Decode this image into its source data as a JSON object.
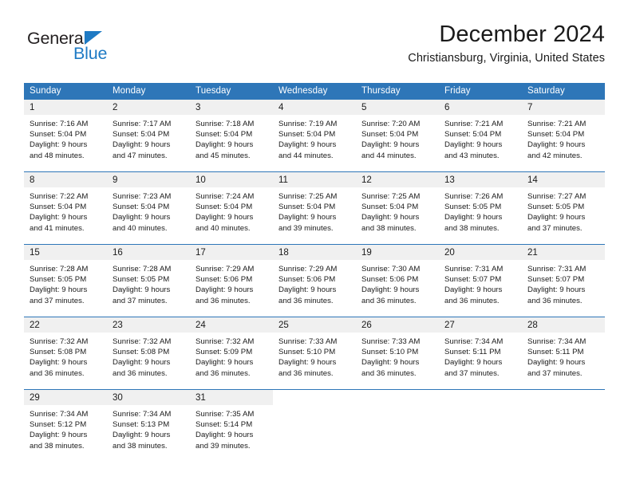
{
  "brand": {
    "name_top": "General",
    "name_bottom": "Blue",
    "accent_color": "#1e7ac4"
  },
  "header": {
    "title": "December 2024",
    "subtitle": "Christiansburg, Virginia, United States"
  },
  "theme": {
    "header_row_background": "#2e76b8",
    "daynum_background": "#f0f0f0",
    "grid_line": "#2e76b8",
    "text": "#1a1a1a"
  },
  "weekday_headers": [
    "Sunday",
    "Monday",
    "Tuesday",
    "Wednesday",
    "Thursday",
    "Friday",
    "Saturday"
  ],
  "weeks": [
    [
      {
        "day": "1",
        "sunrise": "Sunrise: 7:16 AM",
        "sunset": "Sunset: 5:04 PM",
        "daylight_line1": "Daylight: 9 hours",
        "daylight_line2": "and 48 minutes."
      },
      {
        "day": "2",
        "sunrise": "Sunrise: 7:17 AM",
        "sunset": "Sunset: 5:04 PM",
        "daylight_line1": "Daylight: 9 hours",
        "daylight_line2": "and 47 minutes."
      },
      {
        "day": "3",
        "sunrise": "Sunrise: 7:18 AM",
        "sunset": "Sunset: 5:04 PM",
        "daylight_line1": "Daylight: 9 hours",
        "daylight_line2": "and 45 minutes."
      },
      {
        "day": "4",
        "sunrise": "Sunrise: 7:19 AM",
        "sunset": "Sunset: 5:04 PM",
        "daylight_line1": "Daylight: 9 hours",
        "daylight_line2": "and 44 minutes."
      },
      {
        "day": "5",
        "sunrise": "Sunrise: 7:20 AM",
        "sunset": "Sunset: 5:04 PM",
        "daylight_line1": "Daylight: 9 hours",
        "daylight_line2": "and 44 minutes."
      },
      {
        "day": "6",
        "sunrise": "Sunrise: 7:21 AM",
        "sunset": "Sunset: 5:04 PM",
        "daylight_line1": "Daylight: 9 hours",
        "daylight_line2": "and 43 minutes."
      },
      {
        "day": "7",
        "sunrise": "Sunrise: 7:21 AM",
        "sunset": "Sunset: 5:04 PM",
        "daylight_line1": "Daylight: 9 hours",
        "daylight_line2": "and 42 minutes."
      }
    ],
    [
      {
        "day": "8",
        "sunrise": "Sunrise: 7:22 AM",
        "sunset": "Sunset: 5:04 PM",
        "daylight_line1": "Daylight: 9 hours",
        "daylight_line2": "and 41 minutes."
      },
      {
        "day": "9",
        "sunrise": "Sunrise: 7:23 AM",
        "sunset": "Sunset: 5:04 PM",
        "daylight_line1": "Daylight: 9 hours",
        "daylight_line2": "and 40 minutes."
      },
      {
        "day": "10",
        "sunrise": "Sunrise: 7:24 AM",
        "sunset": "Sunset: 5:04 PM",
        "daylight_line1": "Daylight: 9 hours",
        "daylight_line2": "and 40 minutes."
      },
      {
        "day": "11",
        "sunrise": "Sunrise: 7:25 AM",
        "sunset": "Sunset: 5:04 PM",
        "daylight_line1": "Daylight: 9 hours",
        "daylight_line2": "and 39 minutes."
      },
      {
        "day": "12",
        "sunrise": "Sunrise: 7:25 AM",
        "sunset": "Sunset: 5:04 PM",
        "daylight_line1": "Daylight: 9 hours",
        "daylight_line2": "and 38 minutes."
      },
      {
        "day": "13",
        "sunrise": "Sunrise: 7:26 AM",
        "sunset": "Sunset: 5:05 PM",
        "daylight_line1": "Daylight: 9 hours",
        "daylight_line2": "and 38 minutes."
      },
      {
        "day": "14",
        "sunrise": "Sunrise: 7:27 AM",
        "sunset": "Sunset: 5:05 PM",
        "daylight_line1": "Daylight: 9 hours",
        "daylight_line2": "and 37 minutes."
      }
    ],
    [
      {
        "day": "15",
        "sunrise": "Sunrise: 7:28 AM",
        "sunset": "Sunset: 5:05 PM",
        "daylight_line1": "Daylight: 9 hours",
        "daylight_line2": "and 37 minutes."
      },
      {
        "day": "16",
        "sunrise": "Sunrise: 7:28 AM",
        "sunset": "Sunset: 5:05 PM",
        "daylight_line1": "Daylight: 9 hours",
        "daylight_line2": "and 37 minutes."
      },
      {
        "day": "17",
        "sunrise": "Sunrise: 7:29 AM",
        "sunset": "Sunset: 5:06 PM",
        "daylight_line1": "Daylight: 9 hours",
        "daylight_line2": "and 36 minutes."
      },
      {
        "day": "18",
        "sunrise": "Sunrise: 7:29 AM",
        "sunset": "Sunset: 5:06 PM",
        "daylight_line1": "Daylight: 9 hours",
        "daylight_line2": "and 36 minutes."
      },
      {
        "day": "19",
        "sunrise": "Sunrise: 7:30 AM",
        "sunset": "Sunset: 5:06 PM",
        "daylight_line1": "Daylight: 9 hours",
        "daylight_line2": "and 36 minutes."
      },
      {
        "day": "20",
        "sunrise": "Sunrise: 7:31 AM",
        "sunset": "Sunset: 5:07 PM",
        "daylight_line1": "Daylight: 9 hours",
        "daylight_line2": "and 36 minutes."
      },
      {
        "day": "21",
        "sunrise": "Sunrise: 7:31 AM",
        "sunset": "Sunset: 5:07 PM",
        "daylight_line1": "Daylight: 9 hours",
        "daylight_line2": "and 36 minutes."
      }
    ],
    [
      {
        "day": "22",
        "sunrise": "Sunrise: 7:32 AM",
        "sunset": "Sunset: 5:08 PM",
        "daylight_line1": "Daylight: 9 hours",
        "daylight_line2": "and 36 minutes."
      },
      {
        "day": "23",
        "sunrise": "Sunrise: 7:32 AM",
        "sunset": "Sunset: 5:08 PM",
        "daylight_line1": "Daylight: 9 hours",
        "daylight_line2": "and 36 minutes."
      },
      {
        "day": "24",
        "sunrise": "Sunrise: 7:32 AM",
        "sunset": "Sunset: 5:09 PM",
        "daylight_line1": "Daylight: 9 hours",
        "daylight_line2": "and 36 minutes."
      },
      {
        "day": "25",
        "sunrise": "Sunrise: 7:33 AM",
        "sunset": "Sunset: 5:10 PM",
        "daylight_line1": "Daylight: 9 hours",
        "daylight_line2": "and 36 minutes."
      },
      {
        "day": "26",
        "sunrise": "Sunrise: 7:33 AM",
        "sunset": "Sunset: 5:10 PM",
        "daylight_line1": "Daylight: 9 hours",
        "daylight_line2": "and 36 minutes."
      },
      {
        "day": "27",
        "sunrise": "Sunrise: 7:34 AM",
        "sunset": "Sunset: 5:11 PM",
        "daylight_line1": "Daylight: 9 hours",
        "daylight_line2": "and 37 minutes."
      },
      {
        "day": "28",
        "sunrise": "Sunrise: 7:34 AM",
        "sunset": "Sunset: 5:11 PM",
        "daylight_line1": "Daylight: 9 hours",
        "daylight_line2": "and 37 minutes."
      }
    ],
    [
      {
        "day": "29",
        "sunrise": "Sunrise: 7:34 AM",
        "sunset": "Sunset: 5:12 PM",
        "daylight_line1": "Daylight: 9 hours",
        "daylight_line2": "and 38 minutes."
      },
      {
        "day": "30",
        "sunrise": "Sunrise: 7:34 AM",
        "sunset": "Sunset: 5:13 PM",
        "daylight_line1": "Daylight: 9 hours",
        "daylight_line2": "and 38 minutes."
      },
      {
        "day": "31",
        "sunrise": "Sunrise: 7:35 AM",
        "sunset": "Sunset: 5:14 PM",
        "daylight_line1": "Daylight: 9 hours",
        "daylight_line2": "and 39 minutes."
      },
      {
        "day": "",
        "sunrise": "",
        "sunset": "",
        "daylight_line1": "",
        "daylight_line2": ""
      },
      {
        "day": "",
        "sunrise": "",
        "sunset": "",
        "daylight_line1": "",
        "daylight_line2": ""
      },
      {
        "day": "",
        "sunrise": "",
        "sunset": "",
        "daylight_line1": "",
        "daylight_line2": ""
      },
      {
        "day": "",
        "sunrise": "",
        "sunset": "",
        "daylight_line1": "",
        "daylight_line2": ""
      }
    ]
  ]
}
